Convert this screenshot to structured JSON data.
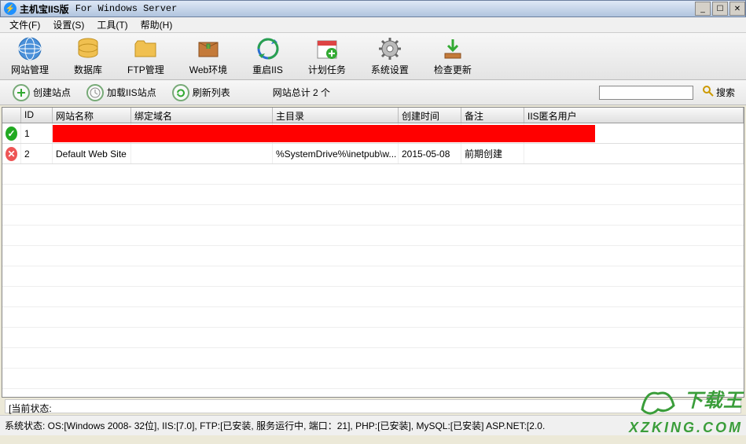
{
  "window": {
    "title": "主机宝IIS版",
    "subtitle": "For Windows Server"
  },
  "menu": {
    "file": "文件(F)",
    "settings": "设置(S)",
    "tools": "工具(T)",
    "help": "帮助(H)"
  },
  "toolbar": {
    "site_mgmt": "网站管理",
    "database": "数据库",
    "ftp_mgmt": "FTP管理",
    "web_env": "Web环境",
    "restart_iis": "重启IIS",
    "scheduled": "计划任务",
    "sys_settings": "系统设置",
    "check_update": "检查更新"
  },
  "actionbar": {
    "create_site": "创建站点",
    "load_iis": "加载IIS站点",
    "refresh": "刷新列表",
    "total": "网站总计 2 个",
    "search": "搜索"
  },
  "grid": {
    "headers": {
      "id": "ID",
      "name": "网站名称",
      "domain": "绑定域名",
      "dir": "主目录",
      "time": "创建时间",
      "note": "备注",
      "user": "IIS匿名用户"
    },
    "rows": [
      {
        "status": "ok",
        "id": "1",
        "name": "",
        "domain": "",
        "dir": "",
        "time": "",
        "note": "",
        "user": ""
      },
      {
        "status": "err",
        "id": "2",
        "name": "Default Web Site",
        "domain": "",
        "dir": "%SystemDrive%\\inetpub\\w...",
        "time": "2015-05-08",
        "note": "前期创建",
        "user": ""
      }
    ]
  },
  "status": {
    "current_label": "[当前状态:",
    "system": "系统状态: OS:[Windows 2008- 32位], IIS:[7.0], FTP:[已安装, 服务运行中, 端口：21], PHP:[已安装], MySQL:[已安装] ASP.NET:[2.0."
  },
  "watermark": {
    "brand": "下载王",
    "domain": "XZKING.COM"
  }
}
